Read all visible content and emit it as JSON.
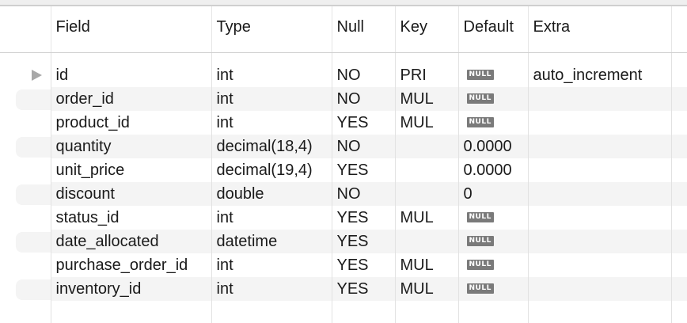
{
  "columns": {
    "field": "Field",
    "type": "Type",
    "null": "Null",
    "key": "Key",
    "default": "Default",
    "extra": "Extra"
  },
  "null_badge": "NULL",
  "rows": [
    {
      "field": "id",
      "type": "int",
      "null": "NO",
      "key": "PRI",
      "default_is_null": true,
      "default": "",
      "extra": "auto_increment",
      "current": true
    },
    {
      "field": "order_id",
      "type": "int",
      "null": "NO",
      "key": "MUL",
      "default_is_null": true,
      "default": "",
      "extra": ""
    },
    {
      "field": "product_id",
      "type": "int",
      "null": "YES",
      "key": "MUL",
      "default_is_null": true,
      "default": "",
      "extra": ""
    },
    {
      "field": "quantity",
      "type": "decimal(18,4)",
      "null": "NO",
      "key": "",
      "default_is_null": false,
      "default": "0.0000",
      "extra": ""
    },
    {
      "field": "unit_price",
      "type": "decimal(19,4)",
      "null": "YES",
      "key": "",
      "default_is_null": false,
      "default": "0.0000",
      "extra": ""
    },
    {
      "field": "discount",
      "type": "double",
      "null": "NO",
      "key": "",
      "default_is_null": false,
      "default": "0",
      "extra": ""
    },
    {
      "field": "status_id",
      "type": "int",
      "null": "YES",
      "key": "MUL",
      "default_is_null": true,
      "default": "",
      "extra": ""
    },
    {
      "field": "date_allocated",
      "type": "datetime",
      "null": "YES",
      "key": "",
      "default_is_null": true,
      "default": "",
      "extra": ""
    },
    {
      "field": "purchase_order_id",
      "type": "int",
      "null": "YES",
      "key": "MUL",
      "default_is_null": true,
      "default": "",
      "extra": ""
    },
    {
      "field": "inventory_id",
      "type": "int",
      "null": "YES",
      "key": "MUL",
      "default_is_null": true,
      "default": "",
      "extra": ""
    }
  ],
  "colors": {
    "stripe": "#f4f4f4",
    "null_badge_bg": "#7a7a7a",
    "selector_arrow": "#a8a8a8"
  }
}
